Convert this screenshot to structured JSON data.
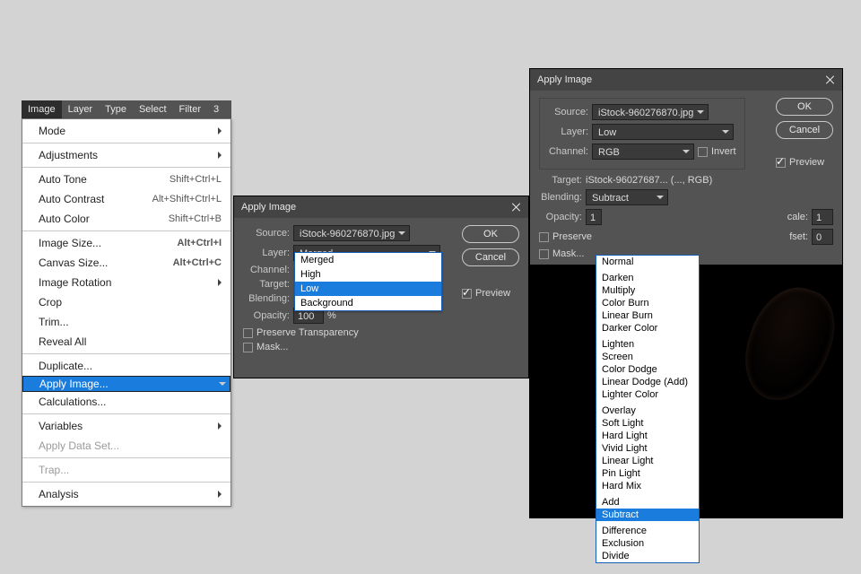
{
  "menubar": [
    "Image",
    "Layer",
    "Type",
    "Select",
    "Filter",
    "3"
  ],
  "menu": {
    "mode": {
      "label": "Mode",
      "sub": true
    },
    "adjustments": {
      "label": "Adjustments",
      "sub": true
    },
    "autoTone": {
      "label": "Auto Tone",
      "key": "Shift+Ctrl+L"
    },
    "autoContrast": {
      "label": "Auto Contrast",
      "key": "Alt+Shift+Ctrl+L"
    },
    "autoColor": {
      "label": "Auto Color",
      "key": "Shift+Ctrl+B"
    },
    "imageSize": {
      "label": "Image Size...",
      "key": "Alt+Ctrl+I"
    },
    "canvasSize": {
      "label": "Canvas Size...",
      "key": "Alt+Ctrl+C"
    },
    "imageRotation": {
      "label": "Image Rotation",
      "sub": true
    },
    "crop": {
      "label": "Crop"
    },
    "trim": {
      "label": "Trim..."
    },
    "revealAll": {
      "label": "Reveal All"
    },
    "duplicate": {
      "label": "Duplicate..."
    },
    "applyImage": {
      "label": "Apply Image..."
    },
    "calculations": {
      "label": "Calculations..."
    },
    "variables": {
      "label": "Variables",
      "sub": true
    },
    "applyDataSet": {
      "label": "Apply Data Set...",
      "disabled": true
    },
    "trap": {
      "label": "Trap...",
      "disabled": true
    },
    "analysis": {
      "label": "Analysis",
      "sub": true
    }
  },
  "labels": {
    "title": "Apply Image",
    "source": "Source:",
    "layer": "Layer:",
    "channel": "Channel:",
    "target": "Target:",
    "blending": "Blending:",
    "opacity": "Opacity:",
    "preserve": "Preserve Transparency",
    "preserveShort": "Preserve",
    "mask": "Mask...",
    "ok": "OK",
    "cancel": "Cancel",
    "preview": "Preview",
    "invert": "Invert",
    "scale": "cale:",
    "offset": "fset:",
    "percent": "%"
  },
  "center": {
    "source": "iStock-960276870.jpg",
    "layerCurrent": "Merged",
    "layerOptions": [
      "Merged",
      "High",
      "Low",
      "Background"
    ],
    "layerSelected": "Low",
    "opacity": "100"
  },
  "right": {
    "source": "iStock-960276870.jpg",
    "layer": "Low",
    "channel": "RGB",
    "target": "iStock-96027687... (..., RGB)",
    "blending": "Subtract",
    "opacity": "1",
    "scale": "1",
    "offset": "0",
    "blendOptions": [
      [
        "Normal"
      ],
      [
        "Darken",
        "Multiply",
        "Color Burn",
        "Linear Burn",
        "Darker Color"
      ],
      [
        "Lighten",
        "Screen",
        "Color Dodge",
        "Linear Dodge (Add)",
        "Lighter Color"
      ],
      [
        "Overlay",
        "Soft Light",
        "Hard Light",
        "Vivid Light",
        "Linear Light",
        "Pin Light",
        "Hard Mix"
      ],
      [
        "Add",
        "Subtract"
      ],
      [
        "Difference",
        "Exclusion",
        "Divide"
      ]
    ]
  }
}
